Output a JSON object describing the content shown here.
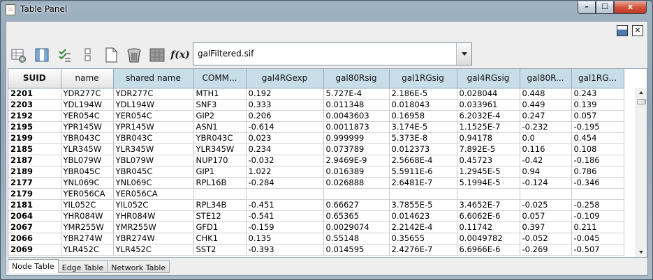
{
  "window": {
    "title": "Table Panel",
    "close_glyph": "x",
    "max_glyph": "☐",
    "min_glyph": "–"
  },
  "panel": {
    "undock_icon": "panel-undock-icon",
    "close_icon": "panel-close-icon"
  },
  "toolbar": {
    "icons": [
      "table-settings-icon",
      "column-chooser-icon",
      "select-all-icon",
      "hide-columns-icon",
      "new-column-icon",
      "delete-column-icon",
      "network-grid-icon",
      "function-builder-icon"
    ],
    "fx_label": "f(x)",
    "network_combo": {
      "value": "galFiltered.sif"
    }
  },
  "table": {
    "headers": [
      "SUID",
      "name",
      "shared name",
      "COMM...",
      "gal4RGexp",
      "gal80Rsig",
      "gal1RGsig",
      "gal4RGsig",
      "gal80R...",
      "gal1RG..."
    ],
    "header_colors": {
      "plain": "#e8e8e8",
      "attribute": "#c7dde8"
    },
    "rows": [
      [
        "2201",
        "YDR277C",
        "YDR277C",
        "MTH1",
        "0.192",
        "5.727E-4",
        "2.186E-5",
        "0.028044",
        "0.448",
        "0.243"
      ],
      [
        "2203",
        "YDL194W",
        "YDL194W",
        "SNF3",
        "0.333",
        "0.011348",
        "0.018043",
        "0.033961",
        "0.449",
        "0.139"
      ],
      [
        "2192",
        "YER054C",
        "YER054C",
        "GIP2",
        "0.206",
        "0.0043603",
        "0.16958",
        "6.2032E-4",
        "0.247",
        "0.057"
      ],
      [
        "2195",
        "YPR145W",
        "YPR145W",
        "ASN1",
        "-0.614",
        "0.0011873",
        "3.174E-5",
        "1.1525E-7",
        "-0.232",
        "-0.195"
      ],
      [
        "2199",
        "YBR043C",
        "YBR043C",
        "YBR043C",
        "0.023",
        "0.999999",
        "5.373E-8",
        "0.94178",
        "0.0",
        "0.454"
      ],
      [
        "2185",
        "YLR345W",
        "YLR345W",
        "YLR345W",
        "0.234",
        "0.073789",
        "0.012373",
        "7.892E-5",
        "0.116",
        "0.108"
      ],
      [
        "2187",
        "YBL079W",
        "YBL079W",
        "NUP170",
        "-0.032",
        "2.9469E-9",
        "2.5668E-4",
        "0.45723",
        "-0.42",
        "-0.186"
      ],
      [
        "2189",
        "YBR045C",
        "YBR045C",
        "GIP1",
        "1.022",
        "0.016389",
        "5.5911E-6",
        "1.2945E-5",
        "0.94",
        "0.786"
      ],
      [
        "2177",
        "YNL069C",
        "YNL069C",
        "RPL16B",
        "-0.284",
        "0.026888",
        "2.6481E-7",
        "5.1994E-5",
        "-0.124",
        "-0.346"
      ],
      [
        "2179",
        "YER056CA",
        "YER056CA",
        "",
        "",
        "",
        "",
        "",
        "",
        ""
      ],
      [
        "2181",
        "YIL052C",
        "YIL052C",
        "RPL34B",
        "-0.451",
        "0.66627",
        "3.7855E-5",
        "3.4652E-7",
        "-0.025",
        "-0.258"
      ],
      [
        "2064",
        "YHR084W",
        "YHR084W",
        "STE12",
        "-0.541",
        "0.65365",
        "0.014623",
        "6.6062E-6",
        "0.057",
        "-0.109"
      ],
      [
        "2067",
        "YMR255W",
        "YMR255W",
        "GFD1",
        "-0.159",
        "0.0029074",
        "2.2142E-4",
        "0.11742",
        "0.397",
        "0.211"
      ],
      [
        "2066",
        "YBR274W",
        "YBR274W",
        "CHK1",
        "0.135",
        "0.55148",
        "0.35655",
        "0.0049782",
        "-0.052",
        "-0.045"
      ],
      [
        "2069",
        "YLR452C",
        "YLR452C",
        "SST2",
        "-0.393",
        "0.014595",
        "2.4276E-7",
        "6.6966E-6",
        "-0.269",
        "-0.507"
      ]
    ]
  },
  "tabs": [
    "Node Table",
    "Edge Table",
    "Network Table"
  ],
  "active_tab": "Node Table"
}
